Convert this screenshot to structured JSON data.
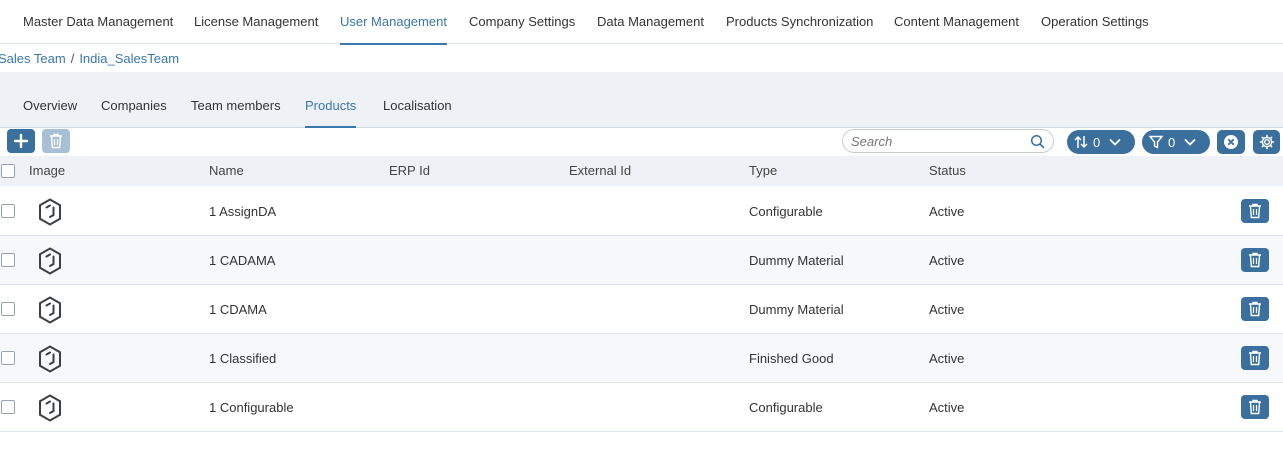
{
  "topnav": {
    "items": [
      {
        "label": "Master Data Management"
      },
      {
        "label": "License Management"
      },
      {
        "label": "User Management",
        "active": true
      },
      {
        "label": "Company Settings"
      },
      {
        "label": "Data Management"
      },
      {
        "label": "Products Synchronization"
      },
      {
        "label": "Content Management"
      },
      {
        "label": "Operation Settings"
      }
    ]
  },
  "breadcrumb": {
    "parent": "Sales Team",
    "separator": "/",
    "current": "India_SalesTeam"
  },
  "subtabs": [
    {
      "label": "Overview"
    },
    {
      "label": "Companies"
    },
    {
      "label": "Team members"
    },
    {
      "label": "Products",
      "active": true
    },
    {
      "label": "Localisation"
    }
  ],
  "toolbar": {
    "add_icon": "plus-icon",
    "delete_icon": "trash-icon",
    "search_placeholder": "Search",
    "sort_count": "0",
    "filter_count": "0",
    "clear_icon": "close-circle-icon",
    "settings_icon": "gear-icon"
  },
  "table": {
    "columns": [
      "Image",
      "Name",
      "ERP Id",
      "External Id",
      "Type",
      "Status"
    ],
    "rows": [
      {
        "name": "1 AssignDA",
        "erp_id": "",
        "external_id": "",
        "type": "Configurable",
        "status": "Active"
      },
      {
        "name": "1 CADAMA",
        "erp_id": "",
        "external_id": "",
        "type": "Dummy Material",
        "status": "Active"
      },
      {
        "name": "1 CDAMA",
        "erp_id": "",
        "external_id": "",
        "type": "Dummy Material",
        "status": "Active"
      },
      {
        "name": "1 Classified",
        "erp_id": "",
        "external_id": "",
        "type": "Finished Good",
        "status": "Active"
      },
      {
        "name": "1 Configurable",
        "erp_id": "",
        "external_id": "",
        "type": "Configurable",
        "status": "Active"
      }
    ]
  },
  "colors": {
    "accent": "#3a77ad",
    "button": "#3a6f9e",
    "header_bg": "#eef2f6"
  }
}
